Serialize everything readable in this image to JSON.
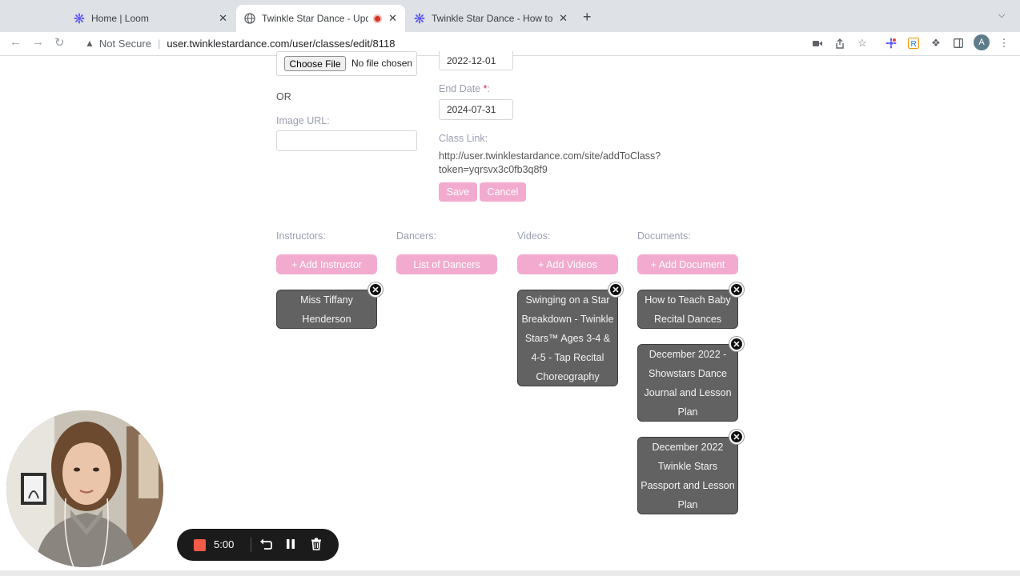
{
  "browser": {
    "tabs": [
      {
        "title": "Home | Loom",
        "icon": "loom-icon"
      },
      {
        "title": "Twinkle Star Dance - Upda",
        "icon": "globe-icon",
        "recording": true
      },
      {
        "title": "Twinkle Star Dance - How to R",
        "icon": "loom-icon"
      }
    ],
    "close_glyph": "✕",
    "new_tab_glyph": "+",
    "security_label": "Not Secure",
    "url": "user.twinklestardance.com/user/classes/edit/8118",
    "avatar_letter": "A"
  },
  "form": {
    "choose_file_label": "Choose File",
    "no_file_text": "No file chosen",
    "start_date_value": "2022-12-01",
    "or_text": "OR",
    "image_url_label": "Image URL:",
    "image_url_value": "",
    "end_date_label": "End Date",
    "required_mark": "*",
    "end_date_colon": ":",
    "end_date_value": "2024-07-31",
    "class_link_label": "Class Link:",
    "class_link_line1": "http://user.twinklestardance.com/site/addToClass?",
    "class_link_line2": "token=yqrsvx3c0fb3q8f9",
    "save_label": "Save",
    "cancel_label": "Cancel"
  },
  "columns": {
    "instructors": {
      "label": "Instructors:",
      "add_label": "+ Add Instructor",
      "items": [
        "Miss Tiffany Henderson"
      ]
    },
    "dancers": {
      "label": "Dancers:",
      "add_label": "List of Dancers",
      "items": []
    },
    "videos": {
      "label": "Videos:",
      "add_label": "+ Add Videos",
      "items": [
        "Swinging on a Star Breakdown - Twinkle Stars™ Ages 3-4 & 4-5 - Tap Recital Choreography"
      ]
    },
    "documents": {
      "label": "Documents:",
      "add_label": "+ Add Document",
      "items": [
        "How to Teach Baby Recital Dances",
        "December 2022 - Showstars Dance Journal and Lesson Plan",
        "December 2022 Twinkle Stars Passport and Lesson Plan"
      ]
    }
  },
  "remove_glyph": "✕",
  "recorder": {
    "time": "5:00"
  },
  "colors": {
    "accent_pink": "#f2abce",
    "card_gray": "#626262",
    "record_red": "#f15a46"
  }
}
